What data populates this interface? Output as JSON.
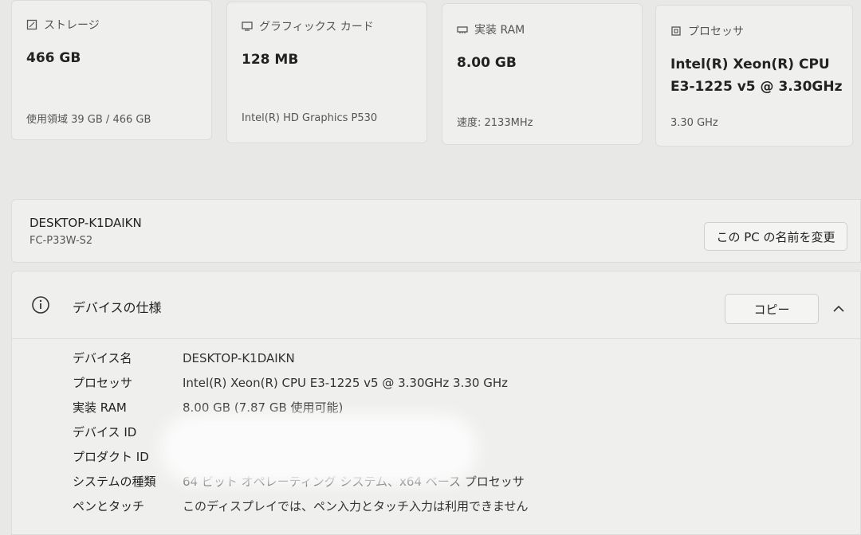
{
  "cards": {
    "storage": {
      "label": "ストレージ",
      "value": "466 GB",
      "sub": "使用領域 39 GB / 466 GB",
      "icon": "storage-icon"
    },
    "gpu": {
      "label": "グラフィックス カード",
      "value": "128 MB",
      "sub": "Intel(R) HD Graphics P530",
      "icon": "display-icon"
    },
    "ram": {
      "label": "実装 RAM",
      "value": "8.00 GB",
      "sub": "速度: 2133MHz",
      "icon": "memory-icon"
    },
    "cpu": {
      "label": "プロセッサ",
      "value_line1": "Intel(R) Xeon(R) CPU",
      "value_line2": "E3-1225 v5 @ 3.30GHz",
      "sub": "3.30 GHz",
      "icon": "chip-icon"
    }
  },
  "device": {
    "name": "DESKTOP-K1DAIKN",
    "model": "FC-P33W-S2",
    "rename_label": "この PC の名前を変更"
  },
  "spec": {
    "title": "デバイスの仕様",
    "copy_label": "コピー",
    "rows": [
      {
        "key": "デバイス名",
        "value": "DESKTOP-K1DAIKN"
      },
      {
        "key": "プロセッサ",
        "value": "Intel(R) Xeon(R) CPU E3-1225 v5 @ 3.30GHz   3.30 GHz"
      },
      {
        "key": "実装 RAM",
        "value": "8.00 GB (7.87 GB 使用可能)"
      },
      {
        "key": "デバイス ID",
        "value": ""
      },
      {
        "key": "プロダクト ID",
        "value": ""
      },
      {
        "key": "システムの種類",
        "value": "64 ビット オペレーティング システム、x64 ベース プロセッサ"
      },
      {
        "key": "ペンとタッチ",
        "value": "このディスプレイでは、ペン入力とタッチ入力は利用できません"
      }
    ]
  },
  "colors": {
    "background": "#e8e8e6",
    "card": "#efefed",
    "border": "#dcdcda",
    "text": "#222222"
  }
}
